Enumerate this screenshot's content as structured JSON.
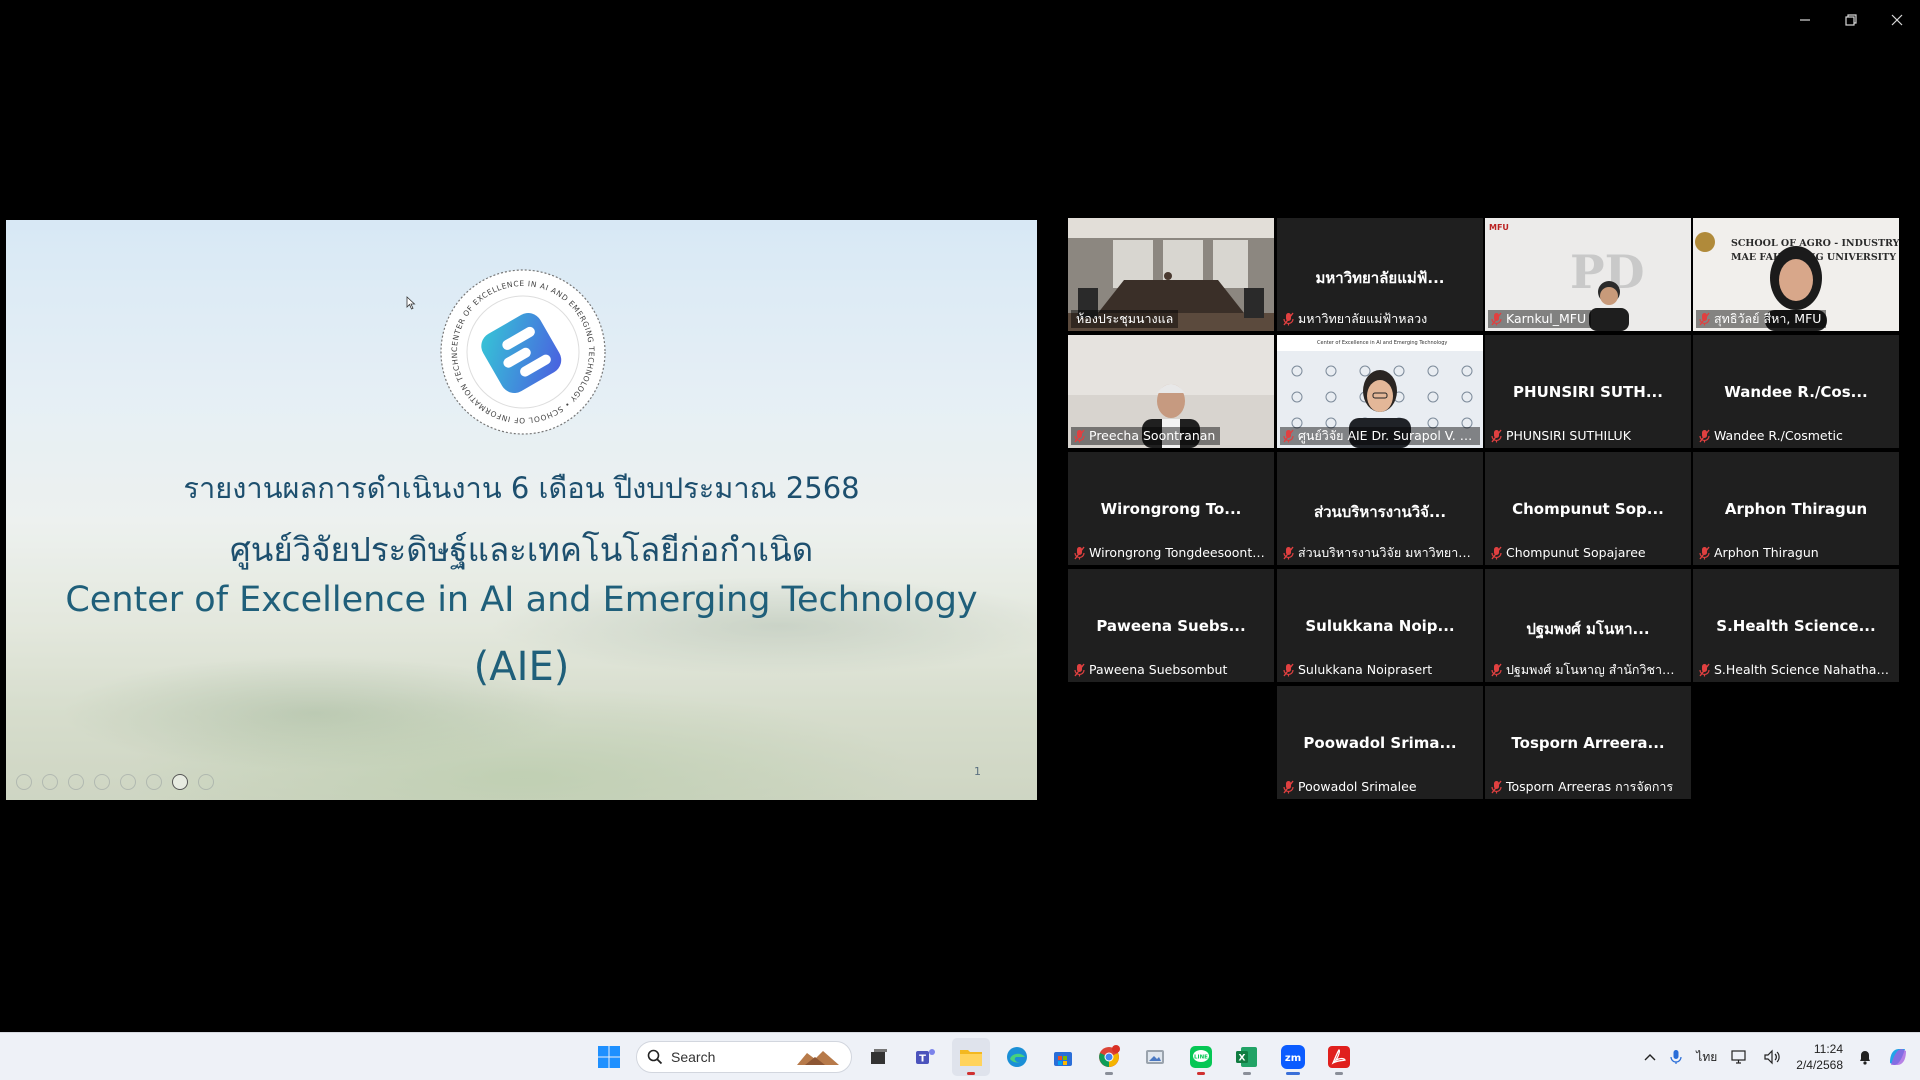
{
  "window": {
    "controls": [
      "minimize",
      "restore",
      "close"
    ]
  },
  "slide": {
    "line1": "รายงานผลการดำเนินงาน 6 เดือน ปีงบประมาณ 2568",
    "line2": "ศูนย์วิจัยประดิษฐ์และเทคโนโลยีก่อกำเนิด",
    "line3": "Center of Excellence in AI and Emerging Technology",
    "line4": "(AIE)",
    "logo_ring_text": "CENTER OF EXCELLENCE IN AI AND EMERGING TECHNOLOGY • SCHOOL OF INFORMATION TECHNOLOGY • MFU",
    "page_number": "1"
  },
  "participants": [
    {
      "center": "",
      "label": "ห้องประชุมนางแล",
      "muted": false,
      "video": true,
      "active": true
    },
    {
      "center": "มหาวิทยาลัยแม่ฟ้...",
      "label": "มหาวิทยาลัยแม่ฟ้าหลวง",
      "muted": true,
      "video": false
    },
    {
      "center": "",
      "label": "Karnkul_MFU",
      "muted": true,
      "video": true,
      "overlay": "MFU"
    },
    {
      "center": "",
      "label": "สุทธิวัลย์ สีหา, MFU",
      "muted": true,
      "video": true,
      "overlay": "SCHOOL OF AGRO - INDUSTRY MAE FAH LUANG UNIVERSITY"
    },
    {
      "center": "",
      "label": "Preecha Soontranan",
      "muted": true,
      "video": true
    },
    {
      "center": "",
      "label": "ศูนย์วิจัย AIE Dr. Surapol V. (Aj...",
      "muted": true,
      "video": true
    },
    {
      "center": "PHUNSIRI SUTH...",
      "label": "PHUNSIRI SUTHILUK",
      "muted": true,
      "video": false
    },
    {
      "center": "Wandee R./Cos...",
      "label": "Wandee R./Cosmetic",
      "muted": true,
      "video": false
    },
    {
      "center": "Wirongrong To...",
      "label": "Wirongrong Tongdeesoontorn",
      "muted": true,
      "video": false
    },
    {
      "center": "ส่วนบริหารงานวิจั...",
      "label": "ส่วนบริหารงานวิจัย มหาวิทยาลัยแม่...",
      "muted": true,
      "video": false
    },
    {
      "center": "Chompunut Sop...",
      "label": "Chompunut Sopajaree",
      "muted": true,
      "video": false
    },
    {
      "center": "Arphon Thiragun",
      "label": "Arphon Thiragun",
      "muted": true,
      "video": false
    },
    {
      "center": "Paweena Suebs...",
      "label": "Paweena Suebsombut",
      "muted": true,
      "video": false
    },
    {
      "center": "Sulukkana Noip...",
      "label": "Sulukkana Noiprasert",
      "muted": true,
      "video": false
    },
    {
      "center": "ปฐมพงศ์ มโนหา...",
      "label": "ปฐมพงศ์ มโนหาญ สำนักวิชานวัตกร...",
      "muted": true,
      "video": false
    },
    {
      "center": "S.Health Science...",
      "label": "S.Health Science Nahathai Du...",
      "muted": true,
      "video": false
    },
    {
      "center": "Poowadol Srima...",
      "label": "Poowadol Srimalee",
      "muted": true,
      "video": false
    },
    {
      "center": "Tosporn Arreera...",
      "label": "Tosporn Arreeras การจัดการ",
      "muted": true,
      "video": false
    }
  ],
  "taskbar": {
    "search_placeholder": "Search",
    "apps": [
      "start-icon",
      "search",
      "task-view-icon",
      "teams-icon",
      "file-explorer-icon",
      "edge-icon",
      "store-icon",
      "chrome-icon",
      "photos-icon",
      "line-icon",
      "excel-icon",
      "zoom-icon",
      "acrobat-icon"
    ],
    "chrome_badge": "",
    "tray": {
      "language": "ไทย",
      "time": "11:24",
      "date": "2/4/2568"
    }
  }
}
